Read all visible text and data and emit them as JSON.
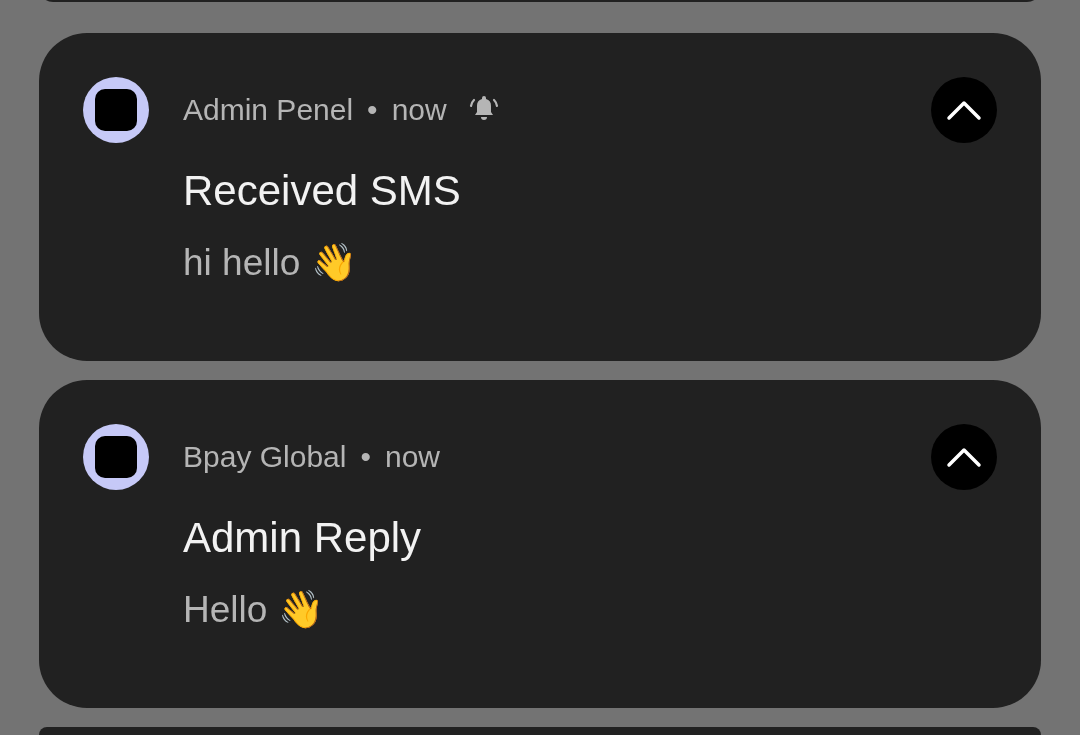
{
  "notifications": [
    {
      "app": "Admin Penel",
      "separator": "•",
      "time": "now",
      "alerting": true,
      "expanded": true,
      "title": "Received SMS",
      "body": "hi hello 👋"
    },
    {
      "app": "Bpay Global",
      "separator": "•",
      "time": "now",
      "alerting": false,
      "expanded": true,
      "title": "Admin Reply",
      "body": "Hello 👋"
    }
  ]
}
